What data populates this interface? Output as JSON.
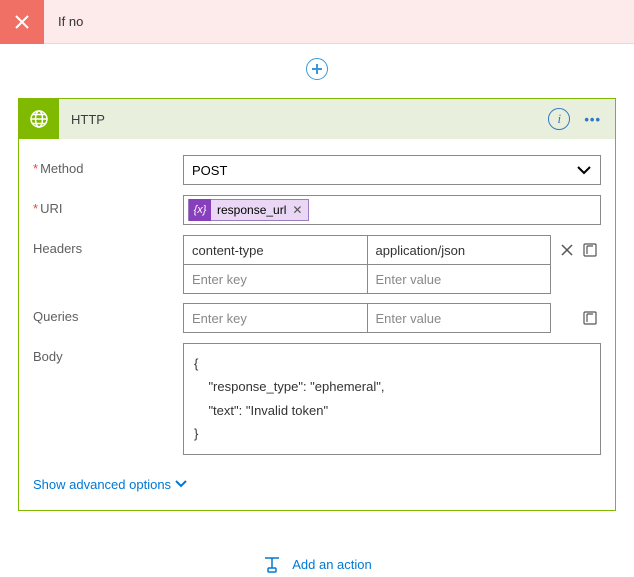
{
  "branch": {
    "label": "If no"
  },
  "card": {
    "title": "HTTP",
    "method": {
      "label": "Method",
      "value": "POST"
    },
    "uri": {
      "label": "URI",
      "token": "response_url"
    },
    "headers": {
      "label": "Headers",
      "rows": [
        {
          "key": "content-type",
          "value": "application/json"
        }
      ],
      "ph_key": "Enter key",
      "ph_value": "Enter value"
    },
    "queries": {
      "label": "Queries",
      "ph_key": "Enter key",
      "ph_value": "Enter value"
    },
    "body": {
      "label": "Body",
      "value": "{\n    \"response_type\": \"ephemeral\",\n    \"text\": \"Invalid token\"\n}"
    },
    "adv": "Show advanced options",
    "token_badge": "{x}"
  },
  "actions": {
    "add": "Add an action"
  }
}
